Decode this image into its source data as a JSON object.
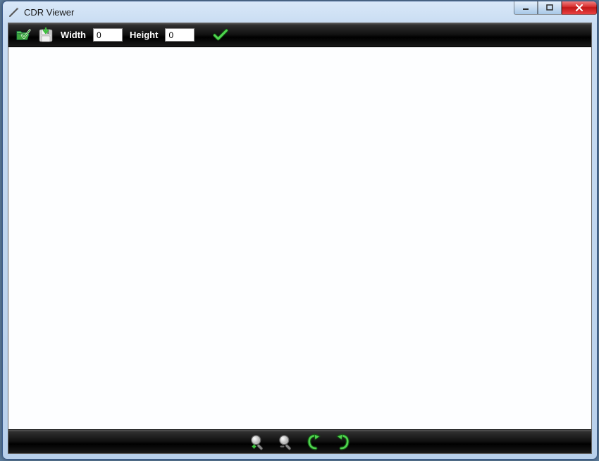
{
  "window": {
    "title": "CDR Viewer"
  },
  "toolbar": {
    "width_label": "Width",
    "width_value": "0",
    "height_label": "Height",
    "height_value": "0"
  }
}
